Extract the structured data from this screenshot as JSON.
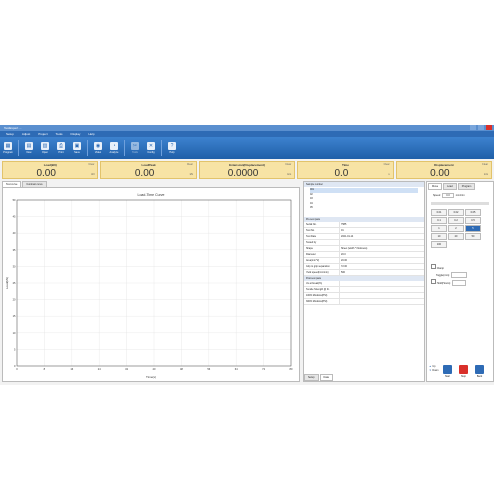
{
  "window": {
    "title": "TestExpert ..."
  },
  "menu": [
    "Setup",
    "Adjust",
    "Project",
    "Tools",
    "Display",
    "Help"
  ],
  "ribbon": [
    {
      "label": "Program",
      "icon": "program-icon",
      "glyph": "▦"
    },
    {
      "label": "New",
      "icon": "new-file-icon",
      "glyph": "▤"
    },
    {
      "label": "Open",
      "icon": "open-icon",
      "glyph": "▥"
    },
    {
      "label": "Print",
      "icon": "print-icon",
      "glyph": "⎙"
    },
    {
      "label": "Save",
      "icon": "save-icon",
      "glyph": "▣"
    },
    {
      "label": "Video",
      "icon": "video-icon",
      "glyph": "◉"
    },
    {
      "label": "Analyze",
      "icon": "analyze-icon",
      "glyph": "◔"
    },
    {
      "label": "Tools",
      "icon": "tools-icon",
      "glyph": "✂"
    },
    {
      "label": "Config",
      "icon": "config-icon",
      "glyph": "✕"
    },
    {
      "label": "Help",
      "icon": "help-icon",
      "glyph": "?"
    }
  ],
  "readouts": [
    {
      "label": "Load(kN)",
      "value": "0.00",
      "unit": "kN",
      "clear": "Clear"
    },
    {
      "label": "LoadPeak",
      "value": "0.00",
      "unit": "kN",
      "clear": "Clear"
    },
    {
      "label": "Extension(Displacement)",
      "value": "0.0000",
      "unit": "mm",
      "clear": "Clear"
    },
    {
      "label": "Time",
      "value": "0.0",
      "unit": "s",
      "clear": "Clear"
    },
    {
      "label": "Displacement",
      "value": "0.00",
      "unit": "mm",
      "clear": "Clear"
    }
  ],
  "chart_tabs": [
    "Test curve",
    "Contrast curve"
  ],
  "chart_data": {
    "type": "line",
    "title": "Load-Time Curve",
    "xlabel": "Time(s)",
    "ylabel": "Load(kN)",
    "xlim": [
      0,
      80
    ],
    "ylim": [
      0,
      50
    ],
    "xticks": [
      0,
      8,
      16,
      24,
      32,
      40,
      48,
      56,
      64,
      72,
      80
    ],
    "yticks": [
      0,
      5,
      10,
      15,
      20,
      25,
      30,
      35,
      40,
      45,
      50
    ],
    "grid": true,
    "series": []
  },
  "sample": {
    "header": "Sample number",
    "items": [
      "001",
      "02",
      "03",
      "04",
      "05"
    ]
  },
  "props": {
    "section1": "Pre-test para",
    "rows": [
      {
        "k": "Serial No.",
        "v": "7585"
      },
      {
        "k": "Test No.",
        "v": "01"
      },
      {
        "k": "Test Date",
        "v": "2021-01-14"
      },
      {
        "k": "Tested by",
        "v": ""
      },
      {
        "k": "Shape",
        "v": "Sheet (width * thickness)"
      },
      {
        "k": "Diameter",
        "v": "20.0"
      },
      {
        "k": "Area(mm^2)",
        "v": "20.00"
      },
      {
        "k": "Grip to grip separation",
        "v": "72.00"
      },
      {
        "k": "Yield speed(mm/min)",
        "v": "500"
      }
    ],
    "section2": "Post-test para",
    "rows2": [
      "UL at break(%)",
      "Tensile Strength @ br.",
      "100% Modulus(PSI)",
      "300% Modulus(PSI)"
    ]
  },
  "mid_tabs": [
    "Setup",
    "Data"
  ],
  "right_tabs": [
    "Move",
    "Load",
    "Program"
  ],
  "speed": {
    "label": "Speed",
    "value": "0.0",
    "unit": "mm/min"
  },
  "speed_buttons": [
    "0.01",
    "0.02",
    "0.05",
    "0.1",
    "0.2",
    "0.5",
    "1",
    "2",
    "5",
    "10",
    "20",
    "50",
    "100"
  ],
  "speed_selected": "5",
  "checks": [
    {
      "label": "Clamp"
    },
    {
      "label": "Toggle(mm):"
    },
    {
      "label": "Hold(Hours):"
    }
  ],
  "controls": [
    {
      "label": "Up",
      "color": "#2e6bb5"
    },
    {
      "label": "Down",
      "color": "#2e6bb5"
    },
    {
      "label": "Start",
      "color": "#2e6bb5"
    },
    {
      "label": "Stop",
      "color": "#d9302a"
    },
    {
      "label": "Back",
      "color": "#2e6bb5"
    }
  ]
}
